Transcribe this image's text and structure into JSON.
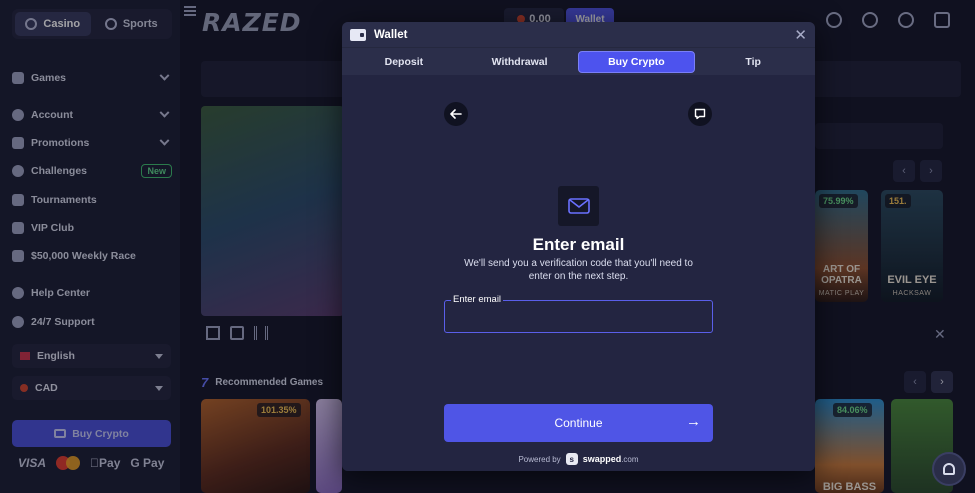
{
  "sidebar": {
    "modes": [
      {
        "label": "Casino"
      },
      {
        "label": "Sports"
      }
    ],
    "items": [
      {
        "label": "Games",
        "icon": "diamond-icon"
      },
      {
        "label": "Account",
        "icon": "gear-icon"
      },
      {
        "label": "Promotions",
        "icon": "gift-icon"
      },
      {
        "label": "Challenges",
        "icon": "target-icon",
        "badge": "New"
      },
      {
        "label": "Tournaments",
        "icon": "trophy-icon"
      },
      {
        "label": "VIP Club",
        "icon": "vip-icon"
      },
      {
        "label": "$50,000 Weekly Race",
        "icon": "trophy-icon"
      },
      {
        "label": "Help Center",
        "icon": "help-icon"
      },
      {
        "label": "24/7 Support",
        "icon": "headset-icon"
      }
    ],
    "language": "English",
    "currency": "CAD",
    "buy_crypto": "Buy Crypto",
    "payments": [
      "VISA",
      "Pay",
      "G Pay"
    ]
  },
  "header": {
    "logo": "RAZED",
    "balance": "0.00",
    "wallet_label": "Wallet"
  },
  "background": {
    "recommended_title": "Recommended Games",
    "cards": [
      {
        "pct": "75.99%",
        "title": "ART OF",
        "title2": "OPATRA",
        "sub": "MATIC PLAY"
      },
      {
        "pct": "151.",
        "title": "EVIL EYE",
        "sub": "HACKSAW"
      },
      {
        "pct": "101.35%"
      },
      {
        "pct": "84.06%",
        "title": "BIG BASS"
      }
    ]
  },
  "modal": {
    "title": "Wallet",
    "tabs": [
      "Deposit",
      "Withdrawal",
      "Buy Crypto",
      "Tip"
    ],
    "active_tab": "Buy Crypto",
    "headline": "Enter email",
    "description": "We'll send you a verification code that you'll need to enter on the next step.",
    "email_label": "Enter email",
    "email_value": "",
    "continue_label": "Continue",
    "powered_by": "Powered by",
    "provider": "swapped",
    "provider_suffix": ".com"
  },
  "colors": {
    "accent": "#4f55e6",
    "background": "#141628",
    "modal": "#232541",
    "new_badge": "#3fbf6e"
  }
}
